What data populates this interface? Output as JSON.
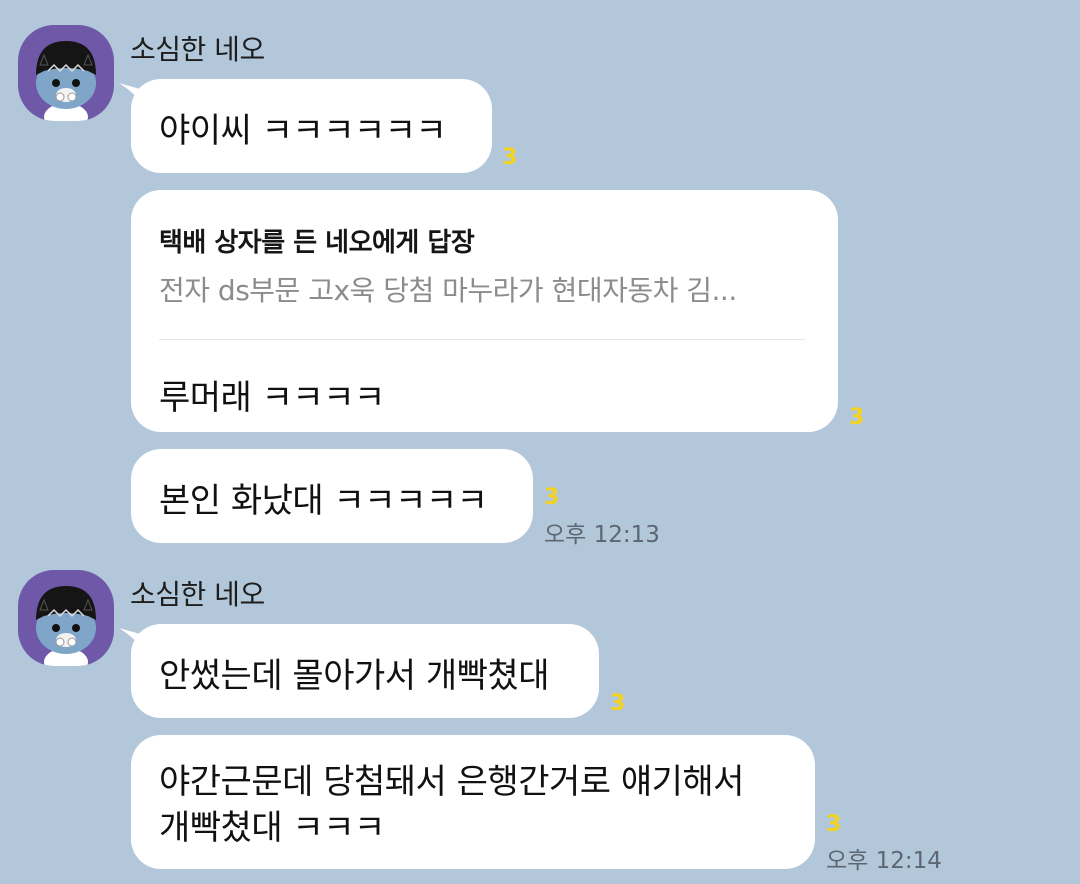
{
  "groups": [
    {
      "sender": "소심한 네오",
      "messages": [
        {
          "text": "야이씨 ㅋㅋㅋㅋㅋㅋ",
          "unread": "3",
          "time": ""
        },
        {
          "reply_title": "택배 상자를 든 네오에게 답장",
          "reply_snippet": "전자 ds부문 고x욱 당첨 마누라가 현대자동차 김...",
          "text": "루머래 ㅋㅋㅋㅋ",
          "unread": "3",
          "time": ""
        },
        {
          "text": "본인 화났대 ㅋㅋㅋㅋㅋ",
          "unread": "3",
          "time": "오후 12:13"
        }
      ]
    },
    {
      "sender": "소심한 네오",
      "messages": [
        {
          "text": "안썼는데 몰아가서 개빡쳤대",
          "unread": "3",
          "time": ""
        },
        {
          "lines": [
            "야간근문데 당첨돼서 은행간거로 얘기해서",
            "개빡쳤대 ㅋㅋㅋ"
          ],
          "unread": "3",
          "time": "오후 12:14"
        }
      ]
    }
  ]
}
